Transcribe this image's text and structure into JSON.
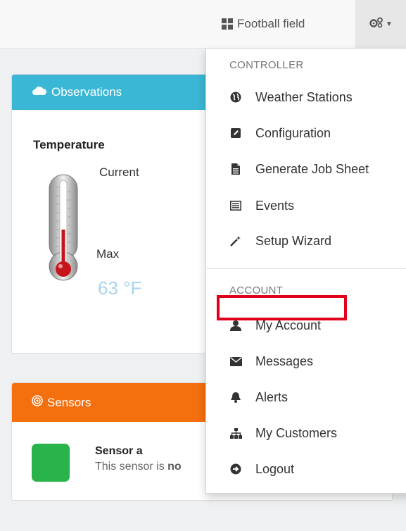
{
  "navbar": {
    "field_label": "Football field",
    "field_icon": "grid-icon",
    "settings_icon": "gears-icon"
  },
  "observations": {
    "title": "Observations",
    "icon": "cloud-icon",
    "header_color": "#3ab7d4",
    "temperature_title": "Temperature",
    "current_label": "Current",
    "max_label": "Max",
    "max_value": "63 °F"
  },
  "sensors": {
    "title": "Sensors",
    "icon": "sensor-icon",
    "header_color": "#f46f0e",
    "sensor_name": "Sensor a",
    "sensor_desc_prefix": "This sensor is ",
    "sensor_desc_bold": "no",
    "status_color": "#28b34b"
  },
  "menu": {
    "controller_header": "CONTROLLER",
    "controller_items": [
      {
        "label": "Weather Stations",
        "icon": "globe-icon"
      },
      {
        "label": "Configuration",
        "icon": "edit-icon"
      },
      {
        "label": "Generate Job Sheet",
        "icon": "file-icon"
      },
      {
        "label": "Events",
        "icon": "list-icon"
      },
      {
        "label": "Setup Wizard",
        "icon": "wand-icon"
      }
    ],
    "account_header": "ACCOUNT",
    "account_items": [
      {
        "label": "My Account",
        "icon": "user-icon"
      },
      {
        "label": "Messages",
        "icon": "envelope-icon"
      },
      {
        "label": "Alerts",
        "icon": "bell-icon"
      },
      {
        "label": "My Customers",
        "icon": "sitemap-icon"
      },
      {
        "label": "Logout",
        "icon": "logout-icon"
      }
    ],
    "highlight_color": "#e0001b"
  }
}
